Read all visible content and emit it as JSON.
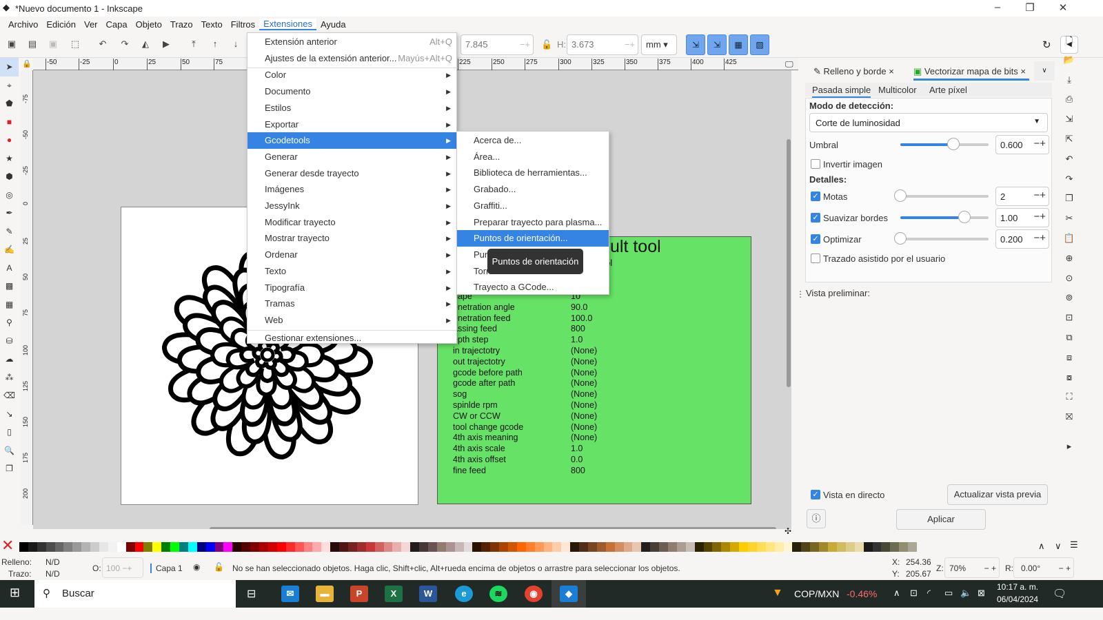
{
  "window": {
    "title": "*Nuevo documento 1 - Inkscape",
    "minimize": "–",
    "maximize": "❐",
    "close": "✕"
  },
  "menubar": [
    "Archivo",
    "Edición",
    "Ver",
    "Capa",
    "Objeto",
    "Trazo",
    "Texto",
    "Filtros",
    "Extensiones",
    "Ayuda"
  ],
  "toolbar": {
    "w_value": "7.845",
    "h_label": "H:",
    "h_value": "3.673",
    "unit": "mm"
  },
  "ruler": {
    "h_ticks": [
      "-50",
      "-25",
      "0",
      "25",
      "50",
      "75",
      "225",
      "250",
      "275",
      "300",
      "325",
      "350",
      "375",
      "400",
      "425"
    ],
    "v_ticks": [
      "-75",
      "-50",
      "-25",
      "0",
      "25",
      "50",
      "75",
      "100",
      "125",
      "150",
      "175",
      "200"
    ]
  },
  "extensions_menu": {
    "items": [
      {
        "label": "Extensión anterior",
        "shortcut": "Alt+Q"
      },
      {
        "label": "Ajustes de la extensión anterior...",
        "shortcut": "Mayús+Alt+Q"
      },
      {
        "label": "Color"
      },
      {
        "label": "Documento"
      },
      {
        "label": "Estilos"
      },
      {
        "label": "Exportar"
      },
      {
        "label": "Gcodetools"
      },
      {
        "label": "Generar"
      },
      {
        "label": "Generar desde trayecto"
      },
      {
        "label": "Imágenes"
      },
      {
        "label": "JessyInk"
      },
      {
        "label": "Modificar trayecto"
      },
      {
        "label": "Mostrar trayecto"
      },
      {
        "label": "Ordenar"
      },
      {
        "label": "Texto"
      },
      {
        "label": "Tipografía"
      },
      {
        "label": "Tramas"
      },
      {
        "label": "Web"
      },
      {
        "label": "Gestionar extensiones..."
      }
    ]
  },
  "gcodetools_submenu": [
    "Acerca de...",
    "Área...",
    "Biblioteca de herramientas...",
    "Grabado...",
    "Graffiti...",
    "Preparar trayecto para plasma...",
    "Puntos de orientación...",
    "Puntos DXF...",
    "Torno...",
    "Trayecto a GCode..."
  ],
  "tooltip": "Puntos de orientación",
  "canvas": {
    "tool_title": "ult tool",
    "tool_sub": "ol",
    "table": [
      [
        "hape",
        "10"
      ],
      [
        "enetration angle",
        "90.0"
      ],
      [
        "enetration feed",
        "100.0"
      ],
      [
        "assing feed",
        "800"
      ],
      [
        "epth step",
        "1.0"
      ],
      [
        "in trajectotry",
        "(None)"
      ],
      [
        "out trajectotry",
        "(None)"
      ],
      [
        "gcode before path",
        "(None)"
      ],
      [
        "gcode after path",
        "(None)"
      ],
      [
        "sog",
        "(None)"
      ],
      [
        "spinlde rpm",
        "(None)"
      ],
      [
        "CW or CCW",
        "(None)"
      ],
      [
        "tool change gcode",
        "(None)"
      ],
      [
        "4th axis meaning",
        "(None)"
      ],
      [
        "4th axis scale",
        "1.0"
      ],
      [
        "4th axis offset",
        "0.0"
      ],
      [
        "fine feed",
        "800"
      ]
    ],
    "green": "#66e266"
  },
  "panel": {
    "tabs": [
      "Relleno y borde",
      "Vectorizar mapa de bits"
    ],
    "subtabs": [
      "Pasada simple",
      "Multicolor",
      "Arte píxel"
    ],
    "mode_label": "Modo de detección:",
    "mode_value": "Corte de luminosidad",
    "umbral_label": "Umbral",
    "umbral_value": "0.600",
    "umbral_level": 0.6,
    "invert_label": "Invertir imagen",
    "details_label": "Detalles:",
    "motas_label": "Motas",
    "motas_value": "2",
    "motas_level": 0,
    "suavizar_label": "Suavizar bordes",
    "suavizar_value": "1.00",
    "suavizar_level": 0.73,
    "optimizar_label": "Optimizar",
    "optimizar_value": "0.200",
    "optimizar_level": 0,
    "asistido_label": "Trazado asistido por el usuario",
    "preview_label": "Vista preliminar:",
    "live_label": "Vista en directo",
    "update_btn": "Actualizar vista previa",
    "apply_btn": "Aplicar"
  },
  "status": {
    "fill_label": "Relleno:",
    "fill_value": "N/D",
    "stroke_label": "Trazo:",
    "stroke_value": "N/D",
    "opacity_label": "O:",
    "opacity_value": "100",
    "layer": "Capa 1",
    "message": "No se han seleccionado objetos. Haga clic, Shift+clic, Alt+rueda encima de objetos o arrastre para seleccionar los objetos.",
    "x_label": "X:",
    "x": "254.36",
    "y_label": "Y:",
    "y": "205.67",
    "zoom_label": "Z:",
    "zoom": "70%",
    "rot_label": "R:",
    "rot": "0.00°"
  },
  "taskbar": {
    "search": "Buscar",
    "ticker": "COP/MXN",
    "change": "-0.46%",
    "time": "10:17 a. m.",
    "date": "06/04/2024"
  },
  "accent": "#3584e4"
}
